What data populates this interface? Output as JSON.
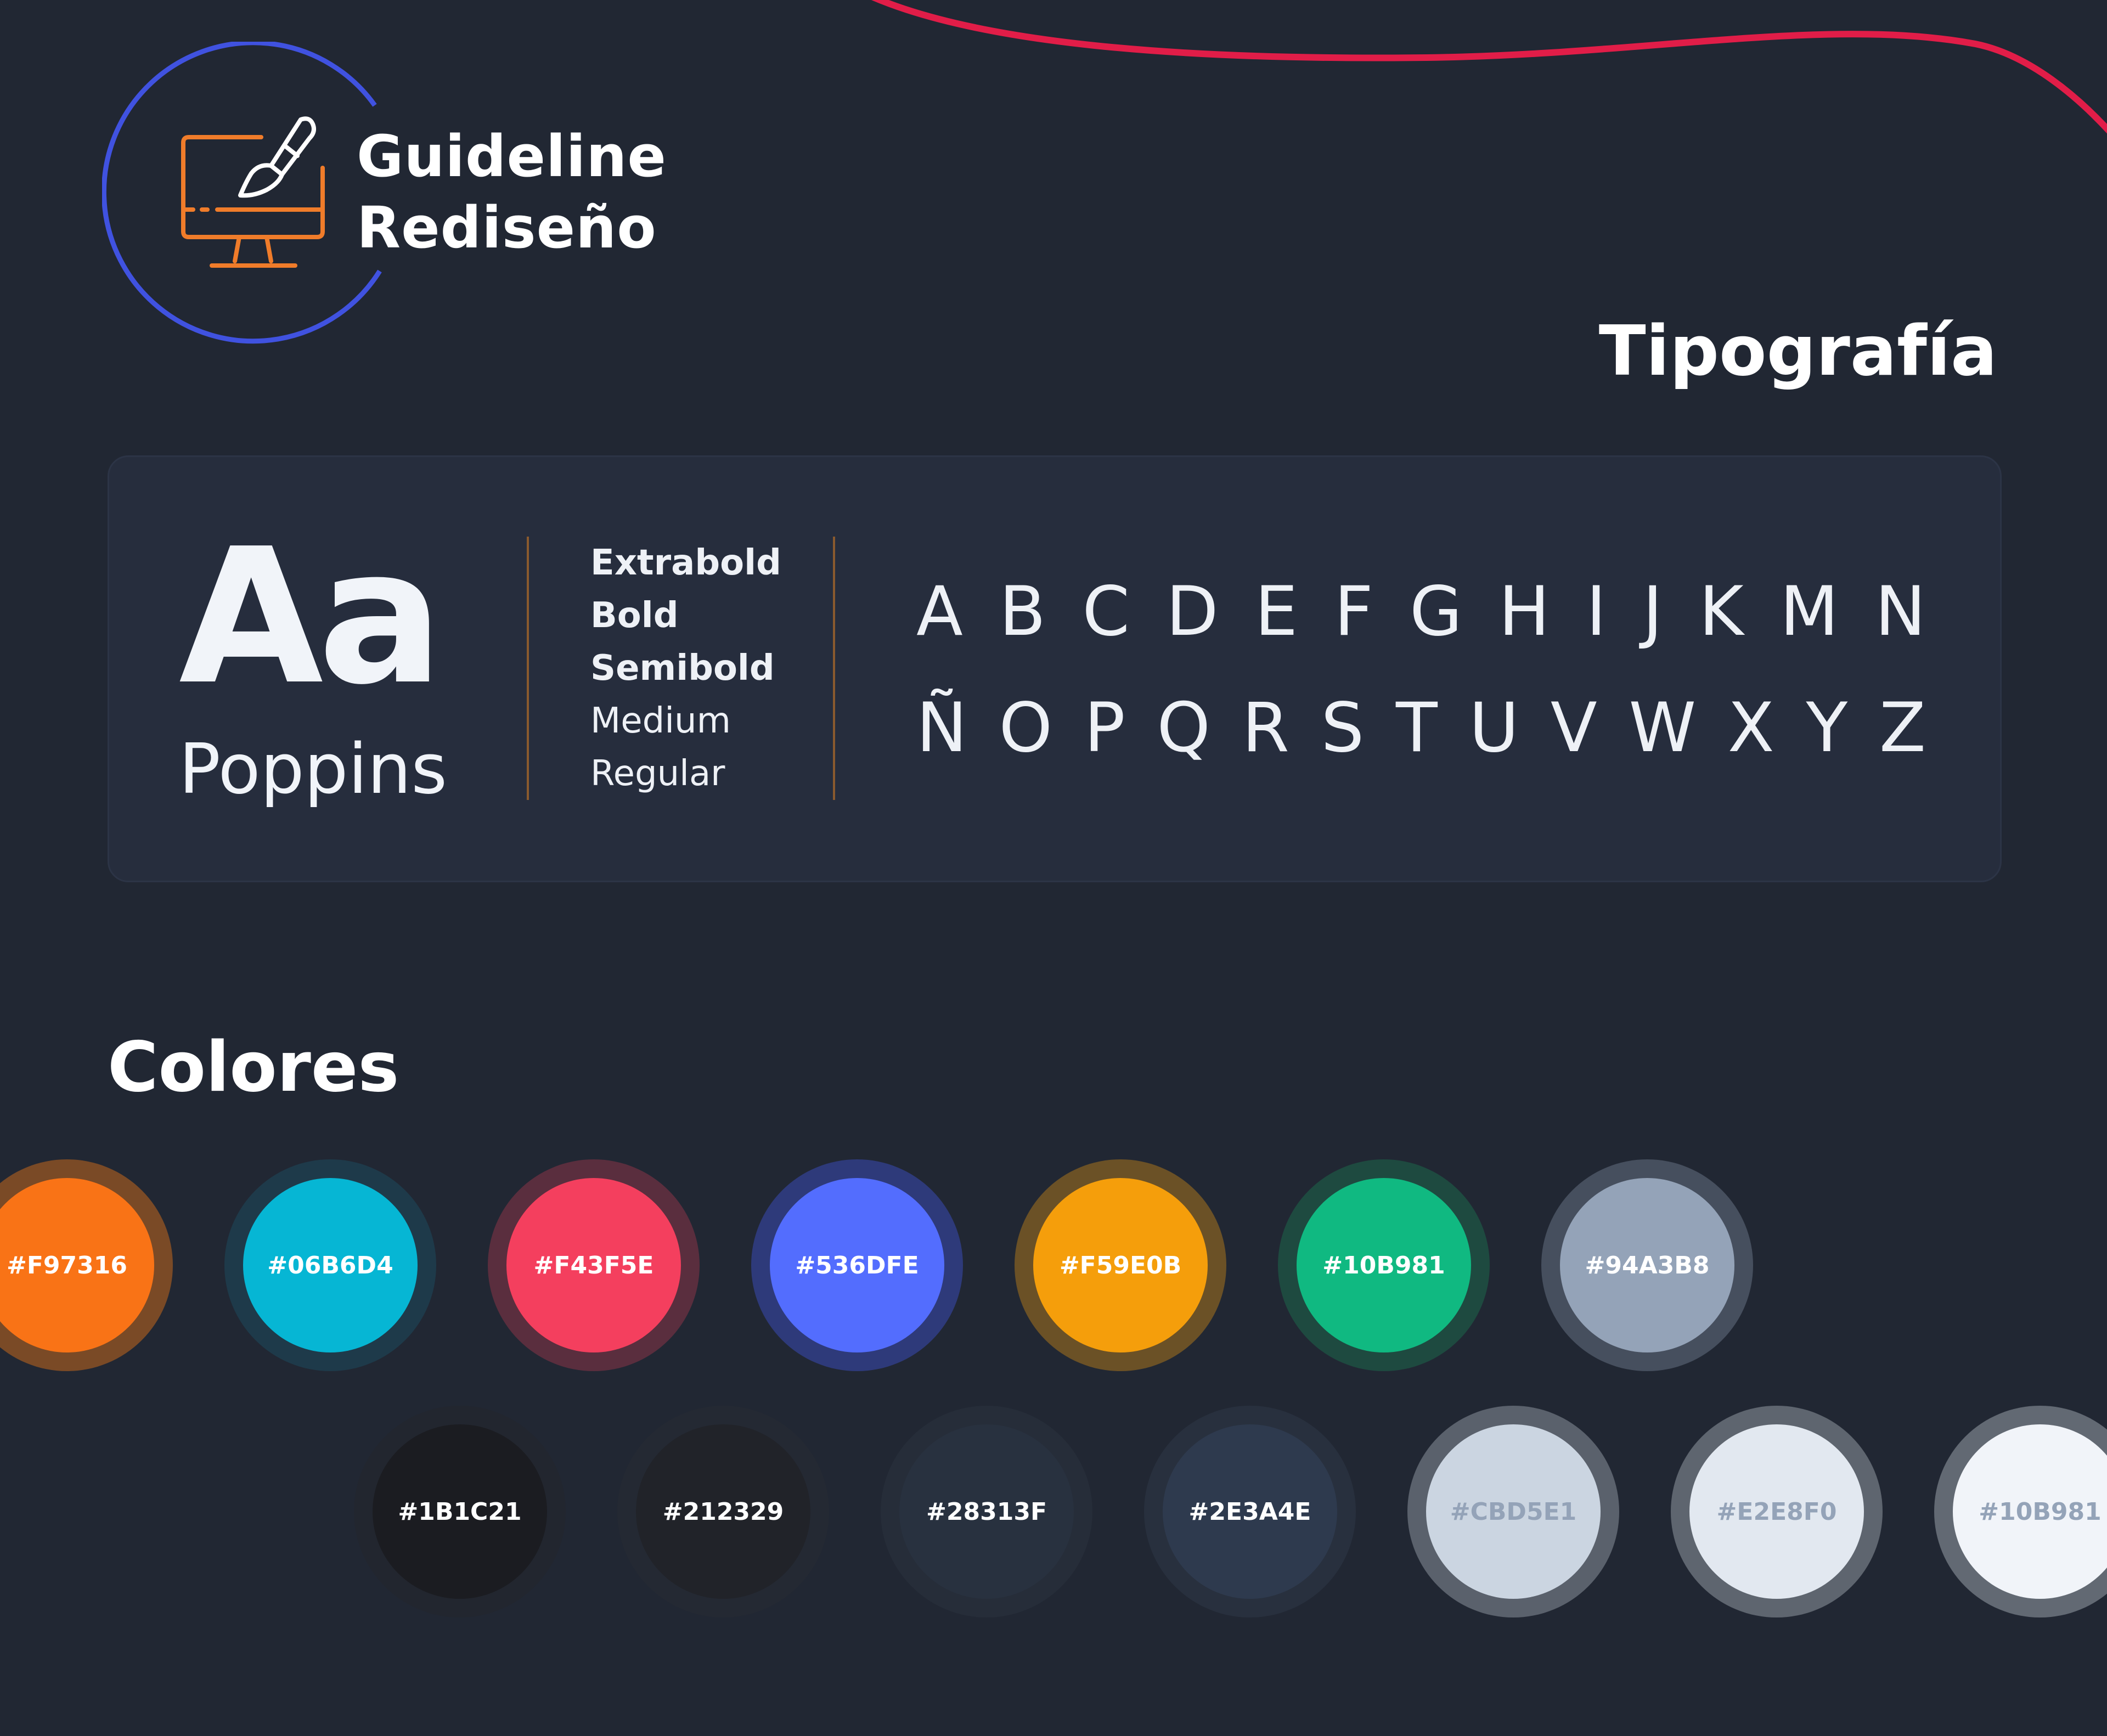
{
  "logo": {
    "line1": "Guideline",
    "line2": "Rediseño",
    "icon": "monitor-paintbrush-icon"
  },
  "typography": {
    "heading": "Tipografía",
    "sample_glyph": "Aa",
    "font_name": "Poppins",
    "weights": [
      "Extrabold",
      "Bold",
      "Semibold",
      "Medium",
      "Regular"
    ],
    "alphabet_row1": [
      "A",
      "B",
      "C",
      "D",
      "E",
      "F",
      "G",
      "H",
      "I",
      "J",
      "K",
      "M",
      "N"
    ],
    "alphabet_row2": [
      "Ñ",
      "O",
      "P",
      "Q",
      "R",
      "S",
      "T",
      "U",
      "V",
      "W",
      "X",
      "Y",
      "Z"
    ]
  },
  "colors": {
    "heading": "Colores",
    "accent_curve": "#E11D48",
    "row1": [
      {
        "label": "#F97316",
        "fill": "#F97316",
        "ring": "#7A4A26",
        "text_color": "#FFFFFF"
      },
      {
        "label": "#06B6D4",
        "fill": "#06B6D4",
        "ring": "#1E3A4A",
        "text_color": "#FFFFFF"
      },
      {
        "label": "#F43F5E",
        "fill": "#F43F5E",
        "ring": "#5A2E3E",
        "text_color": "#FFFFFF"
      },
      {
        "label": "#536DFE",
        "fill": "#536DFE",
        "ring": "#2E3A7A",
        "text_color": "#FFFFFF"
      },
      {
        "label": "#F59E0B",
        "fill": "#F59E0B",
        "ring": "#6B5126",
        "text_color": "#FFFFFF"
      },
      {
        "label": "#10B981",
        "fill": "#10B981",
        "ring": "#1E4A40",
        "text_color": "#FFFFFF"
      },
      {
        "label": "#94A3B8",
        "fill": "#94A3B8",
        "ring": "#464F5E",
        "text_color": "#FFFFFF"
      }
    ],
    "row2": [
      {
        "label": "#1B1C21",
        "fill": "#1B1C21",
        "ring": "#22262F",
        "text_color": "#FFFFFF"
      },
      {
        "label": "#212329",
        "fill": "#212329",
        "ring": "#242933",
        "text_color": "#FFFFFF"
      },
      {
        "label": "#28313F",
        "fill": "#28313F",
        "ring": "#262D39",
        "text_color": "#FFFFFF"
      },
      {
        "label": "#2E3A4E",
        "fill": "#2E3A4E",
        "ring": "#28303E",
        "text_color": "#FFFFFF"
      },
      {
        "label": "#CBD5E1",
        "fill": "#CBD5E1",
        "ring": "#5A616C",
        "text_color": "#94A3B8"
      },
      {
        "label": "#E2E8F0",
        "fill": "#E2E8F0",
        "ring": "#5E656F",
        "text_color": "#94A3B8"
      },
      {
        "label": "#10B981",
        "fill": "#F1F4F9",
        "ring": "#626973",
        "text_color": "#94A3B8"
      }
    ]
  }
}
